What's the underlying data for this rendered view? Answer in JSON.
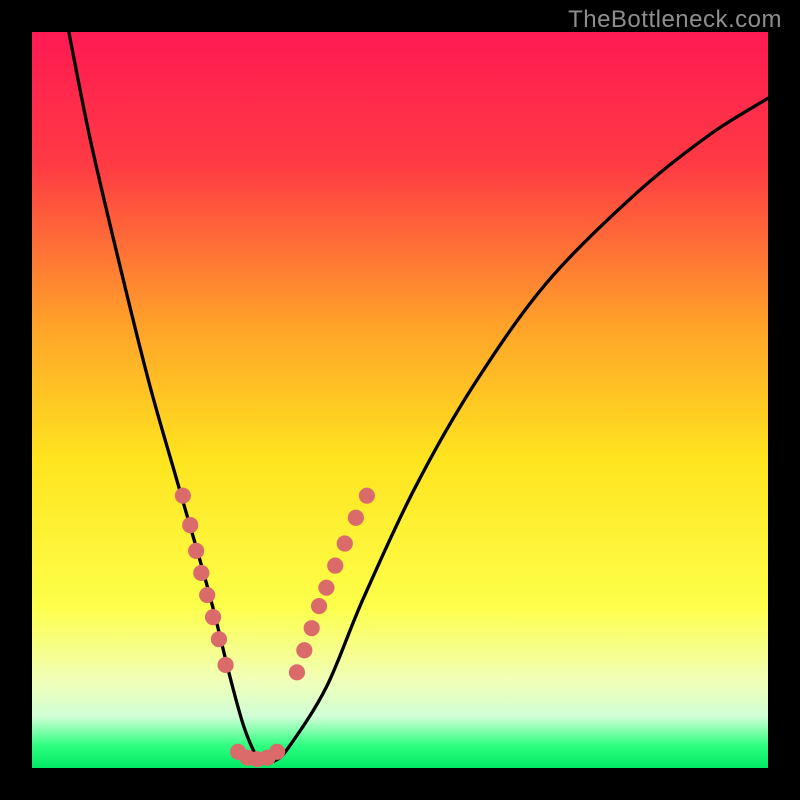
{
  "watermark_text": "TheBottleneck.com",
  "chart_data": {
    "type": "line",
    "title": "",
    "xlabel": "",
    "ylabel": "",
    "xlim": [
      0,
      100
    ],
    "ylim": [
      0,
      100
    ],
    "gradient_stops": [
      {
        "offset": 0,
        "color": "#ff1a52"
      },
      {
        "offset": 18,
        "color": "#ff3a44"
      },
      {
        "offset": 40,
        "color": "#ffa329"
      },
      {
        "offset": 58,
        "color": "#ffe41f"
      },
      {
        "offset": 78,
        "color": "#fdff4a"
      },
      {
        "offset": 88,
        "color": "#f1ffb7"
      },
      {
        "offset": 93,
        "color": "#d1ffd6"
      },
      {
        "offset": 97,
        "color": "#2dff7f"
      },
      {
        "offset": 100,
        "color": "#00e765"
      }
    ],
    "series": [
      {
        "name": "bottleneck-curve",
        "x": [
          5,
          8,
          12,
          16,
          20,
          24,
          27,
          29,
          31,
          33,
          35,
          40,
          45,
          52,
          60,
          70,
          82,
          92,
          100
        ],
        "values": [
          100,
          85,
          68,
          52,
          38,
          24,
          12,
          5,
          1,
          1,
          3,
          11,
          23,
          38,
          52,
          66,
          78,
          86,
          91
        ]
      }
    ],
    "markers": {
      "name": "scatter-dots",
      "color": "#db6b6b",
      "radius_pct": 1.1,
      "points": [
        {
          "x": 20.5,
          "y": 37.0
        },
        {
          "x": 21.5,
          "y": 33.0
        },
        {
          "x": 22.3,
          "y": 29.5
        },
        {
          "x": 23.0,
          "y": 26.5
        },
        {
          "x": 23.8,
          "y": 23.5
        },
        {
          "x": 24.6,
          "y": 20.5
        },
        {
          "x": 25.4,
          "y": 17.5
        },
        {
          "x": 26.3,
          "y": 14.0
        },
        {
          "x": 28.0,
          "y": 2.2
        },
        {
          "x": 29.3,
          "y": 1.4
        },
        {
          "x": 30.6,
          "y": 1.2
        },
        {
          "x": 32.0,
          "y": 1.4
        },
        {
          "x": 33.3,
          "y": 2.2
        },
        {
          "x": 36.0,
          "y": 13.0
        },
        {
          "x": 37.0,
          "y": 16.0
        },
        {
          "x": 38.0,
          "y": 19.0
        },
        {
          "x": 39.0,
          "y": 22.0
        },
        {
          "x": 40.0,
          "y": 24.5
        },
        {
          "x": 41.2,
          "y": 27.5
        },
        {
          "x": 42.5,
          "y": 30.5
        },
        {
          "x": 44.0,
          "y": 34.0
        },
        {
          "x": 45.5,
          "y": 37.0
        }
      ]
    }
  }
}
